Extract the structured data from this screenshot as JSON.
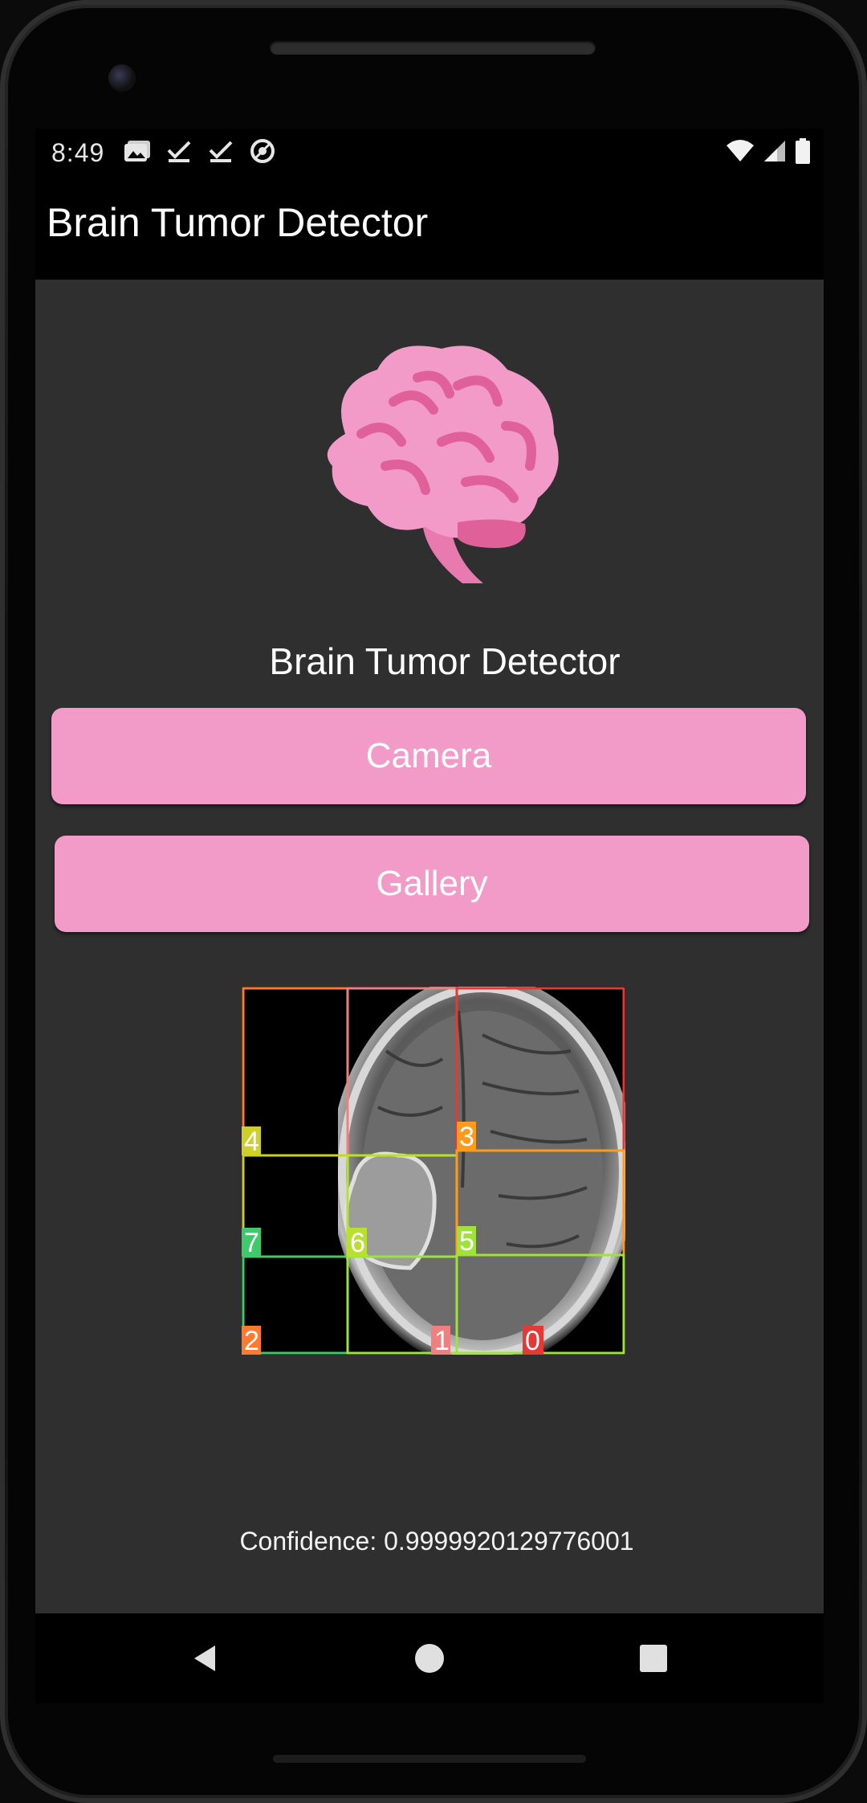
{
  "status_bar": {
    "time": "8:49",
    "left_icons": [
      "gallery-icon",
      "download-done-icon",
      "download-done-icon",
      "vpn-key-icon"
    ],
    "right_icons": [
      "wifi-icon",
      "signal-icon",
      "battery-icon"
    ]
  },
  "app_bar": {
    "title": "Brain Tumor Detector"
  },
  "main": {
    "logo_icon": "brain-icon",
    "heading": "Brain Tumor Detector",
    "camera_button": "Camera",
    "gallery_button": "Gallery",
    "result_image": {
      "description_icon": "mri-scan-image",
      "detections": [
        {
          "id": "0",
          "color": "#e53935"
        },
        {
          "id": "1",
          "color": "#f08080"
        },
        {
          "id": "2",
          "color": "#ff7a2e"
        },
        {
          "id": "3",
          "color": "#ff9a1a"
        },
        {
          "id": "4",
          "color": "#cfcf2a"
        },
        {
          "id": "5",
          "color": "#9ee23a"
        },
        {
          "id": "6",
          "color": "#b8e02f"
        },
        {
          "id": "7",
          "color": "#3ec96a"
        }
      ]
    },
    "confidence_text": "Confidence: 0.9999920129776001"
  },
  "nav_bar": {
    "back": "back-icon",
    "home": "home-icon",
    "recents": "recents-icon"
  },
  "colors": {
    "accent": "#f29bc8",
    "background": "#2f2f2f",
    "bar": "#000000"
  }
}
